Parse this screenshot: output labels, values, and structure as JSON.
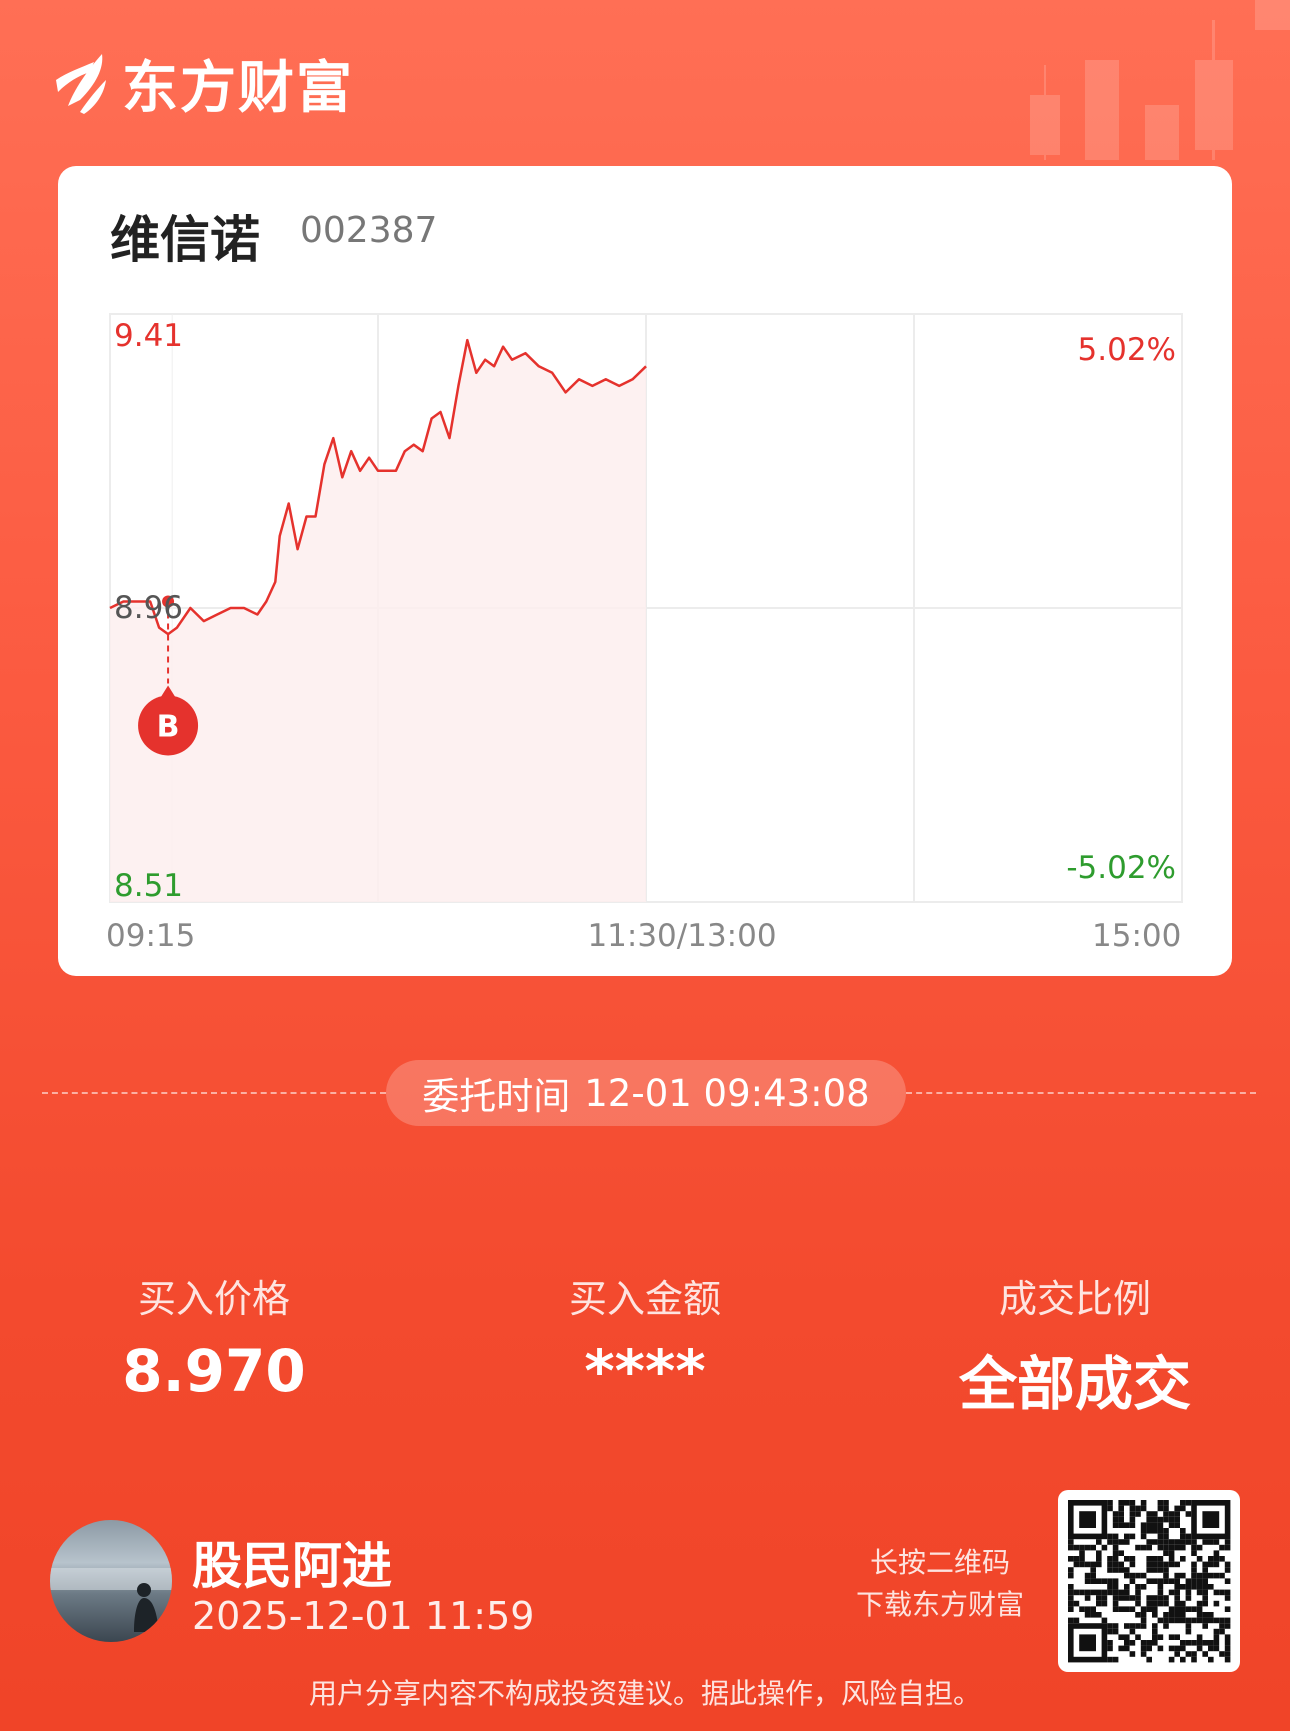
{
  "brand": {
    "name": "东方财富"
  },
  "stock": {
    "name": "维信诺",
    "code": "002387"
  },
  "chart_data": {
    "type": "line",
    "title": "",
    "x_ticks": [
      "09:15",
      "11:30/13:00",
      "15:00"
    ],
    "y_axis": {
      "top": "9.41",
      "mid": "8.96",
      "bottom": "8.51",
      "ylim": [
        8.51,
        9.41
      ]
    },
    "pct_axis": {
      "top": "5.02%",
      "bottom": "-5.02%"
    },
    "series": [
      {
        "x": [
          "09:30",
          "09:33",
          "09:36",
          "09:39",
          "09:41",
          "09:43",
          "09:45",
          "09:48",
          "09:51",
          "09:54",
          "09:57",
          "10:00",
          "10:03",
          "10:05",
          "10:07",
          "10:08",
          "10:10",
          "10:12",
          "10:14",
          "10:16",
          "10:18",
          "10:20",
          "10:22",
          "10:24",
          "10:26",
          "10:28",
          "10:30",
          "10:32",
          "10:34",
          "10:36",
          "10:38",
          "10:40",
          "10:42",
          "10:44",
          "10:46",
          "10:48",
          "10:50",
          "10:52",
          "10:54",
          "10:56",
          "10:58",
          "11:00",
          "11:03",
          "11:06",
          "11:09",
          "11:12",
          "11:15",
          "11:18",
          "11:21",
          "11:24",
          "11:27",
          "11:30"
        ],
        "values": [
          8.96,
          8.97,
          8.97,
          8.97,
          8.93,
          8.92,
          8.93,
          8.96,
          8.94,
          8.95,
          8.96,
          8.96,
          8.95,
          8.97,
          9.0,
          9.07,
          9.12,
          9.05,
          9.1,
          9.1,
          9.18,
          9.22,
          9.16,
          9.2,
          9.17,
          9.19,
          9.17,
          9.17,
          9.17,
          9.2,
          9.21,
          9.2,
          9.25,
          9.26,
          9.22,
          9.3,
          9.37,
          9.32,
          9.34,
          9.33,
          9.36,
          9.34,
          9.35,
          9.33,
          9.32,
          9.29,
          9.31,
          9.3,
          9.31,
          9.3,
          9.31,
          9.33
        ]
      }
    ],
    "marker": {
      "label": "B",
      "time": "09:43",
      "price": 8.97
    }
  },
  "order": {
    "label": "委托时间",
    "time": "12-01 09:43:08"
  },
  "stats": [
    {
      "label": "买入价格",
      "value": "8.970"
    },
    {
      "label": "买入金额",
      "value": "****"
    },
    {
      "label": "成交比例",
      "value": "全部成交"
    }
  ],
  "user": {
    "name": "股民阿进",
    "time": "2025-12-01 11:59"
  },
  "qr": {
    "hint_line1": "长按二维码",
    "hint_line2": "下载东方财富"
  },
  "disclaimer": "用户分享内容不构成投资建议。据此操作，风险自担。",
  "colors": {
    "up": "#e5322d",
    "down": "#2e9c2e",
    "accent": "#f34a2e"
  }
}
